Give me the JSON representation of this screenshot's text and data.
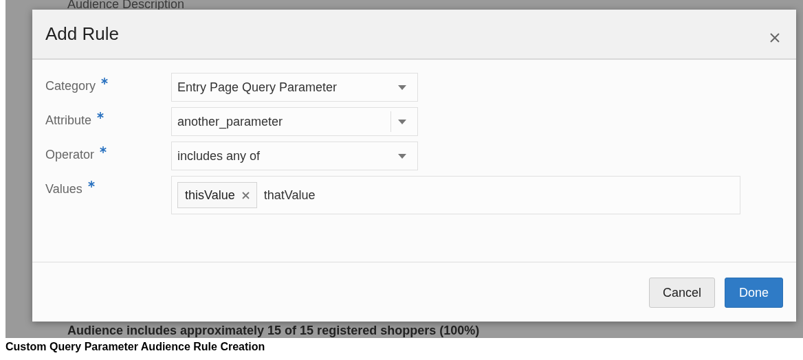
{
  "background": {
    "heading": "Audience Description",
    "summary": "Audience includes approximately 15 of 15 registered shoppers (100%)"
  },
  "dialog": {
    "title": "Add Rule",
    "fields": [
      {
        "label": "Category",
        "required": true,
        "kind": "select",
        "value": "Entry Page Query Parameter"
      },
      {
        "label": "Attribute",
        "required": true,
        "kind": "combobox",
        "value": "another_parameter"
      },
      {
        "label": "Operator",
        "required": true,
        "kind": "select",
        "value": "includes any of"
      },
      {
        "label": "Values",
        "required": true,
        "kind": "tags",
        "tags": [
          "thisValue"
        ],
        "value": "thatValue"
      }
    ],
    "buttons": [
      {
        "label": "Cancel",
        "kind": "secondary"
      },
      {
        "label": "Done",
        "kind": "primary"
      }
    ]
  },
  "caption": "Custom Query Parameter Audience Rule Creation"
}
